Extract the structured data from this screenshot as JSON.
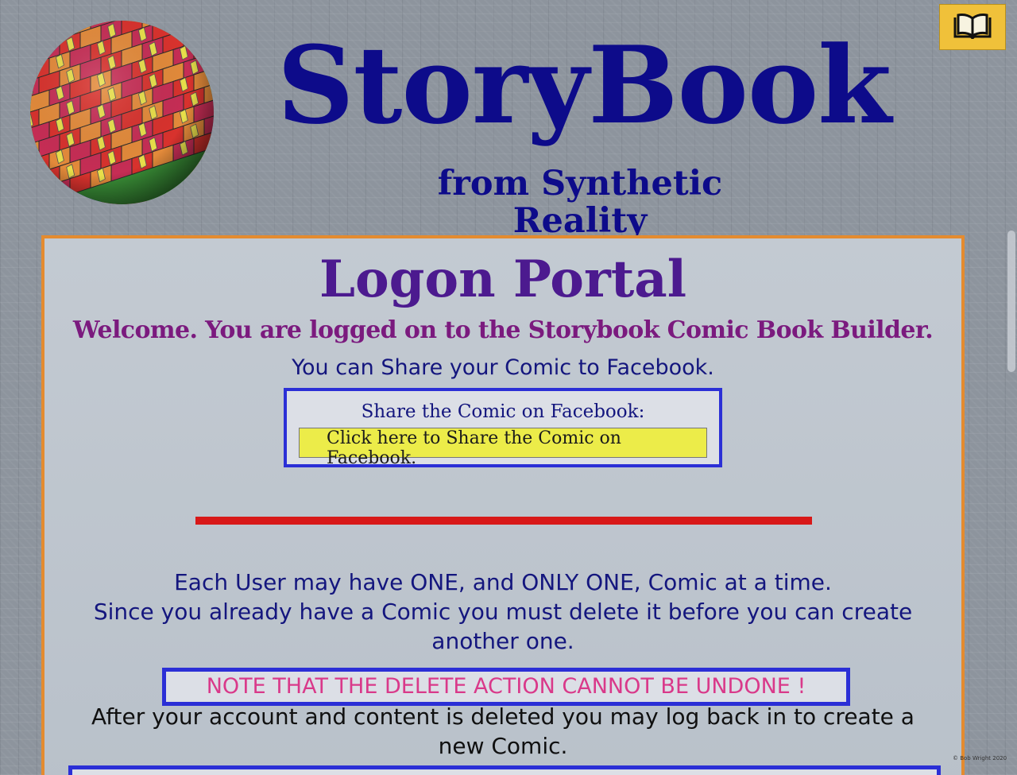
{
  "header": {
    "title": "StoryBook",
    "subtitle": "from Synthetic Reality",
    "book_icon": "open-book-icon",
    "logo_icon": "tiled-sphere-logo"
  },
  "portal": {
    "title": "Logon Portal",
    "welcome": "Welcome. You are logged on to the Storybook Comic Book Builder.",
    "share_note": "You can Share your Comic to Facebook.",
    "share_box_label": "Share the Comic on Facebook:",
    "share_button": "Click here to Share the Comic on Facebook.",
    "rule_line_1": "Each User may have ONE, and ONLY ONE, Comic at a time.",
    "rule_line_2": "Since you already have a Comic you must delete it before you can create another one.",
    "warning": "NOTE THAT THE DELETE ACTION CANNOT BE UNDONE !",
    "after_delete": "After your account and content is deleted you may log back in to create a new Comic."
  },
  "footer": {
    "copyright": "© Bob Wright 2020"
  },
  "colors": {
    "title": "#0d0b8a",
    "portal_title": "#4c1a8f",
    "welcome": "#7b1a7e",
    "panel_border": "#e48b2f",
    "box_border": "#2b2fd6",
    "share_button_bg": "#ecec49",
    "divider": "#d81818",
    "warning_text": "#d9398a",
    "book_button_bg": "#f0c13a"
  }
}
